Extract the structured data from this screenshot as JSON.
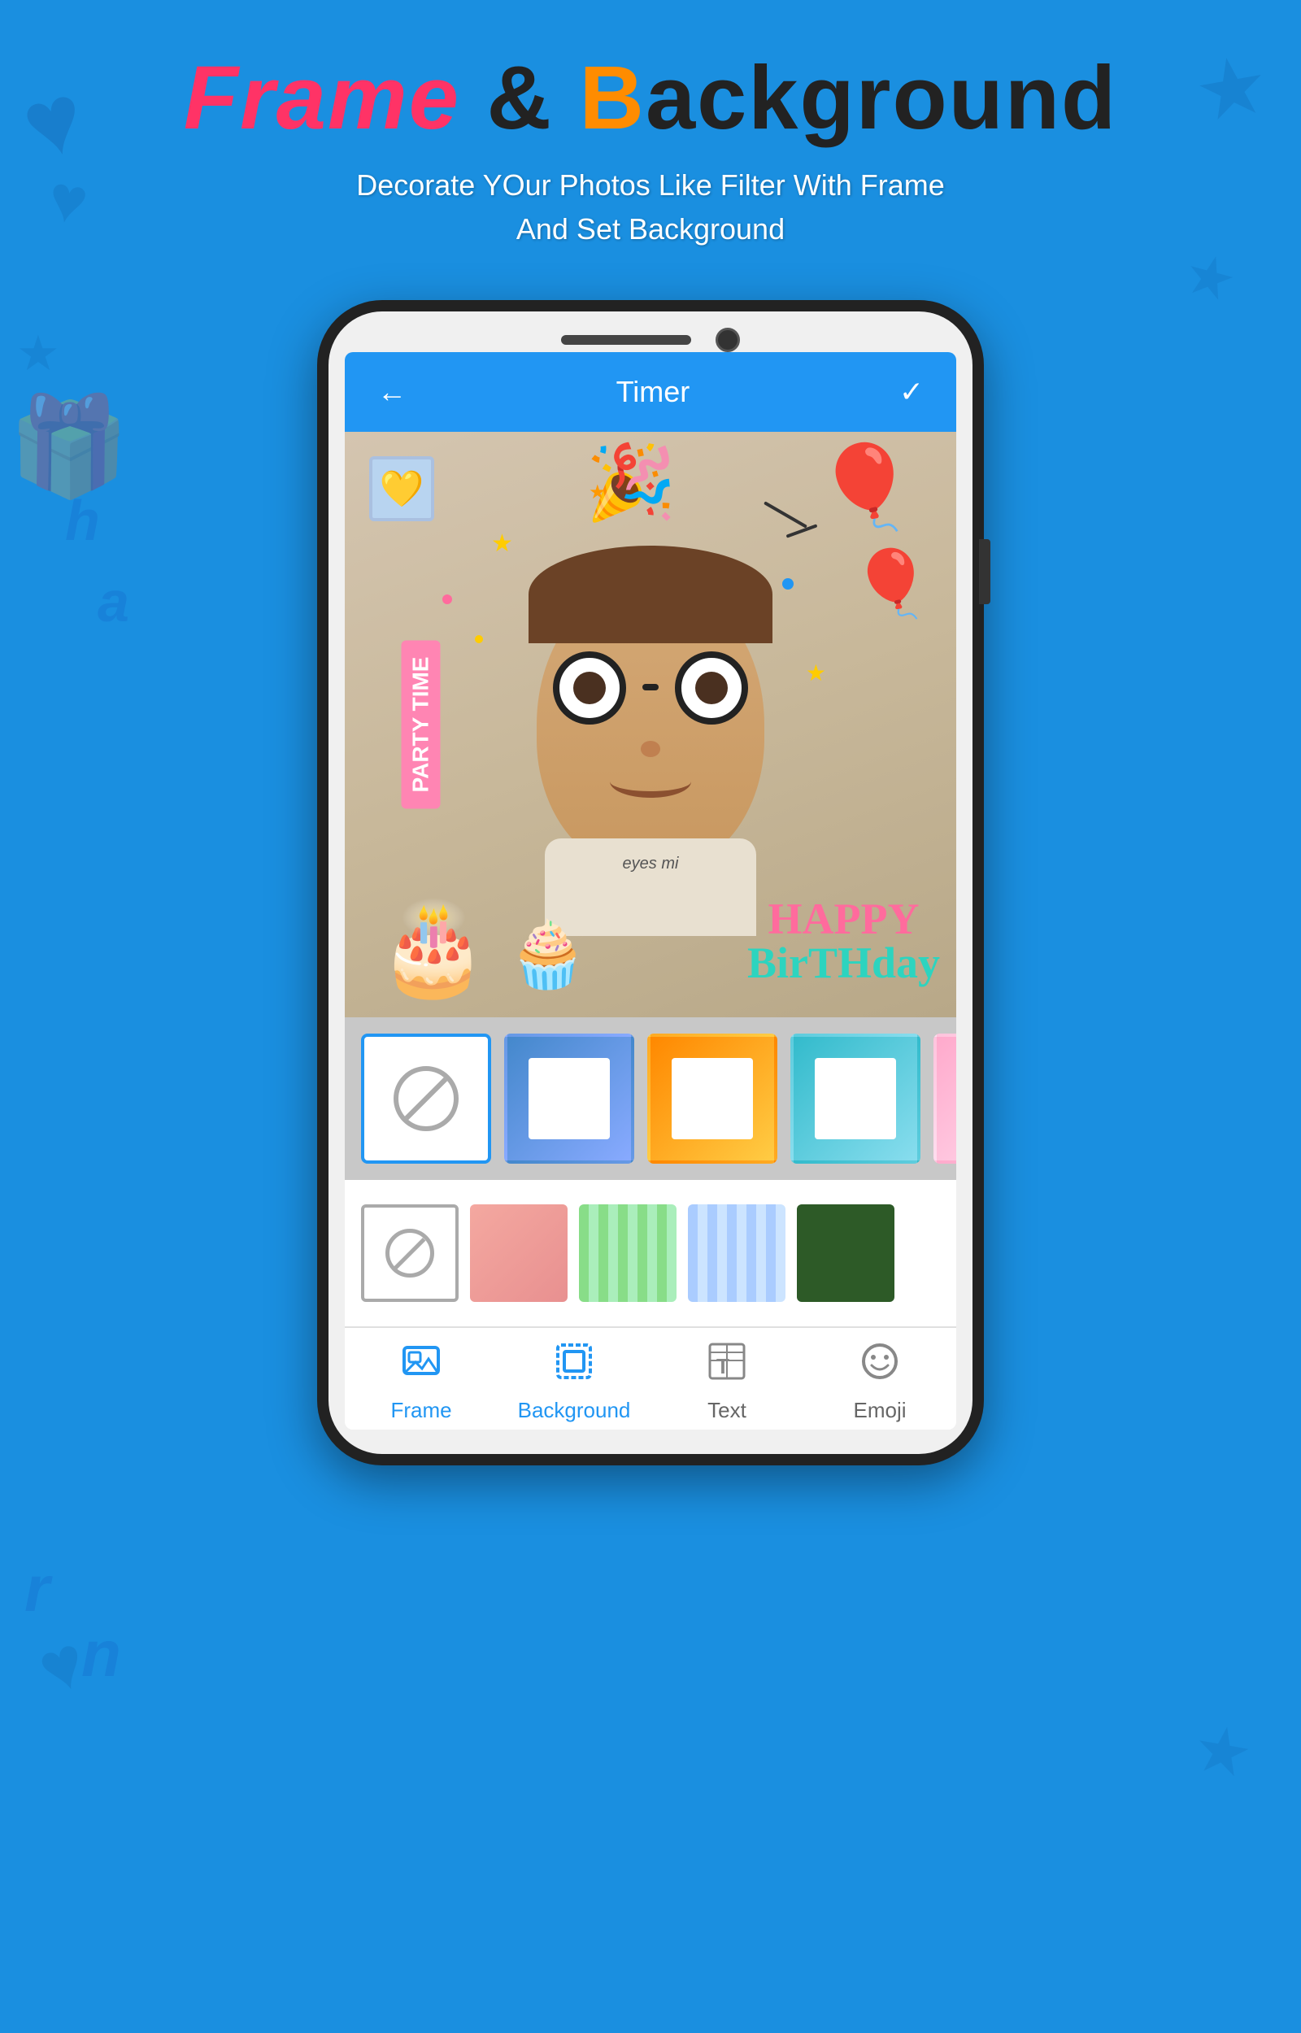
{
  "header": {
    "title_frame": "Frame",
    "title_amp": " & ",
    "title_b": "B",
    "title_background": "ackground",
    "subtitle_line1": "Decorate YOur Photos Like Filter With Frame",
    "subtitle_line2": "And Set Background"
  },
  "phone": {
    "app_header": {
      "back_label": "←",
      "title": "Timer",
      "check_label": "✓"
    },
    "frame_overlay": {
      "party_text": "PARTY TIME",
      "happy_birthday_1": "HAPPY",
      "happy_birthday_2": "BirTHday"
    },
    "no_frame_label": "no-frame",
    "bg_section_no_label": "no-bg"
  },
  "bottom_nav": {
    "items": [
      {
        "id": "frame",
        "label": "Frame",
        "active": true
      },
      {
        "id": "background",
        "label": "Background",
        "active": true
      },
      {
        "id": "text",
        "label": "Text",
        "active": false
      },
      {
        "id": "emoji",
        "label": "Emoji",
        "active": false
      }
    ]
  },
  "colors": {
    "primary": "#2196F3",
    "accent_pink": "#ff3366",
    "accent_orange": "#ff8c00",
    "bg_blue": "#1a8fe0"
  }
}
